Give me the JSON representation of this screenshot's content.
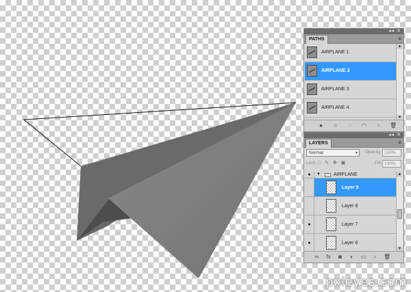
{
  "paths_panel": {
    "tab_label": "PATHS",
    "items": [
      {
        "name": "AIRPLANE 1",
        "selected": false
      },
      {
        "name": "AIRPLANE 2",
        "selected": true
      },
      {
        "name": "AIRPLANE 3",
        "selected": false
      },
      {
        "name": "AIRPLANE 4",
        "selected": false
      }
    ],
    "footer_icons": [
      "fill-path-icon",
      "stroke-path-icon",
      "load-selection-icon",
      "make-work-path-icon",
      "new-path-icon",
      "delete-path-icon"
    ]
  },
  "layers_panel": {
    "tab_label": "LAYERS",
    "blend_mode": "Normal",
    "opacity_label": "Opacity:",
    "opacity_value": "100%",
    "lock_label": "Lock:",
    "fill_label": "Fill:",
    "fill_value": "100%",
    "group": {
      "name": "AIRPLANE",
      "visible": true,
      "expanded": true
    },
    "layers": [
      {
        "name": "Layer 9",
        "visible": false,
        "selected": true
      },
      {
        "name": "Layer 8",
        "visible": false,
        "selected": false
      },
      {
        "name": "Layer 7",
        "visible": true,
        "selected": false
      },
      {
        "name": "Layer 6",
        "visible": true,
        "selected": false
      }
    ],
    "footer_icons": [
      "link-layers-icon",
      "layer-style-icon",
      "layer-mask-icon",
      "adjustment-layer-icon",
      "new-group-icon",
      "new-layer-icon",
      "delete-layer-icon"
    ]
  },
  "watermark": "pxleyes.com",
  "colors": {
    "selection": "#3399ff",
    "panel_bg": "#d6d6d6",
    "airplane_light": "#7b7b7b",
    "airplane_dark": "#5c5c5c"
  }
}
